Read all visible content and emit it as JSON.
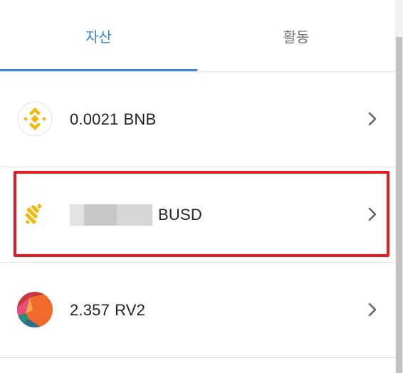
{
  "tabs": {
    "assets_label": "자산",
    "activity_label": "활동",
    "active": "assets"
  },
  "assets": [
    {
      "amount": "0.0021",
      "symbol": "BNB",
      "icon": "bnb-icon"
    },
    {
      "amount": "",
      "symbol": "BUSD",
      "icon": "busd-icon",
      "amount_obscured": true,
      "highlighted": true
    },
    {
      "amount": "2.357",
      "symbol": "RV2",
      "icon": "rv2-icon"
    }
  ],
  "colors": {
    "accent": "#3b86d4",
    "highlight": "#e31b23",
    "bnb": "#f0b90b"
  }
}
